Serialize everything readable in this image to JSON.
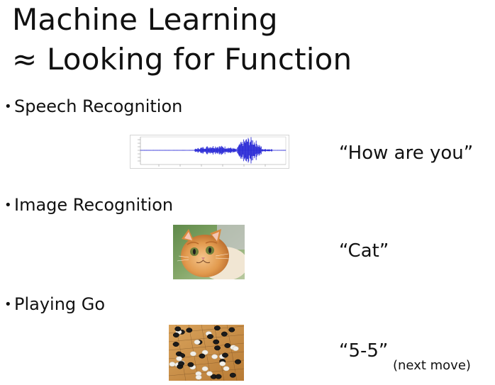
{
  "slide": {
    "title_line1": "Machine Learning",
    "title_line2": "≈ Looking for Function"
  },
  "bullets": [
    {
      "label": "Speech Recognition",
      "output": "“How are you”"
    },
    {
      "label": "Image Recognition",
      "output": "“Cat”"
    },
    {
      "label": "Playing Go",
      "output": "“5-5”",
      "note": "(next move)"
    }
  ],
  "bullet_glyph": "•",
  "images": {
    "speech": "speech-waveform",
    "image": "cat-photo",
    "go": "go-board-photo"
  },
  "colors": {
    "waveform": "#2b2bd6",
    "text": "#111111"
  }
}
